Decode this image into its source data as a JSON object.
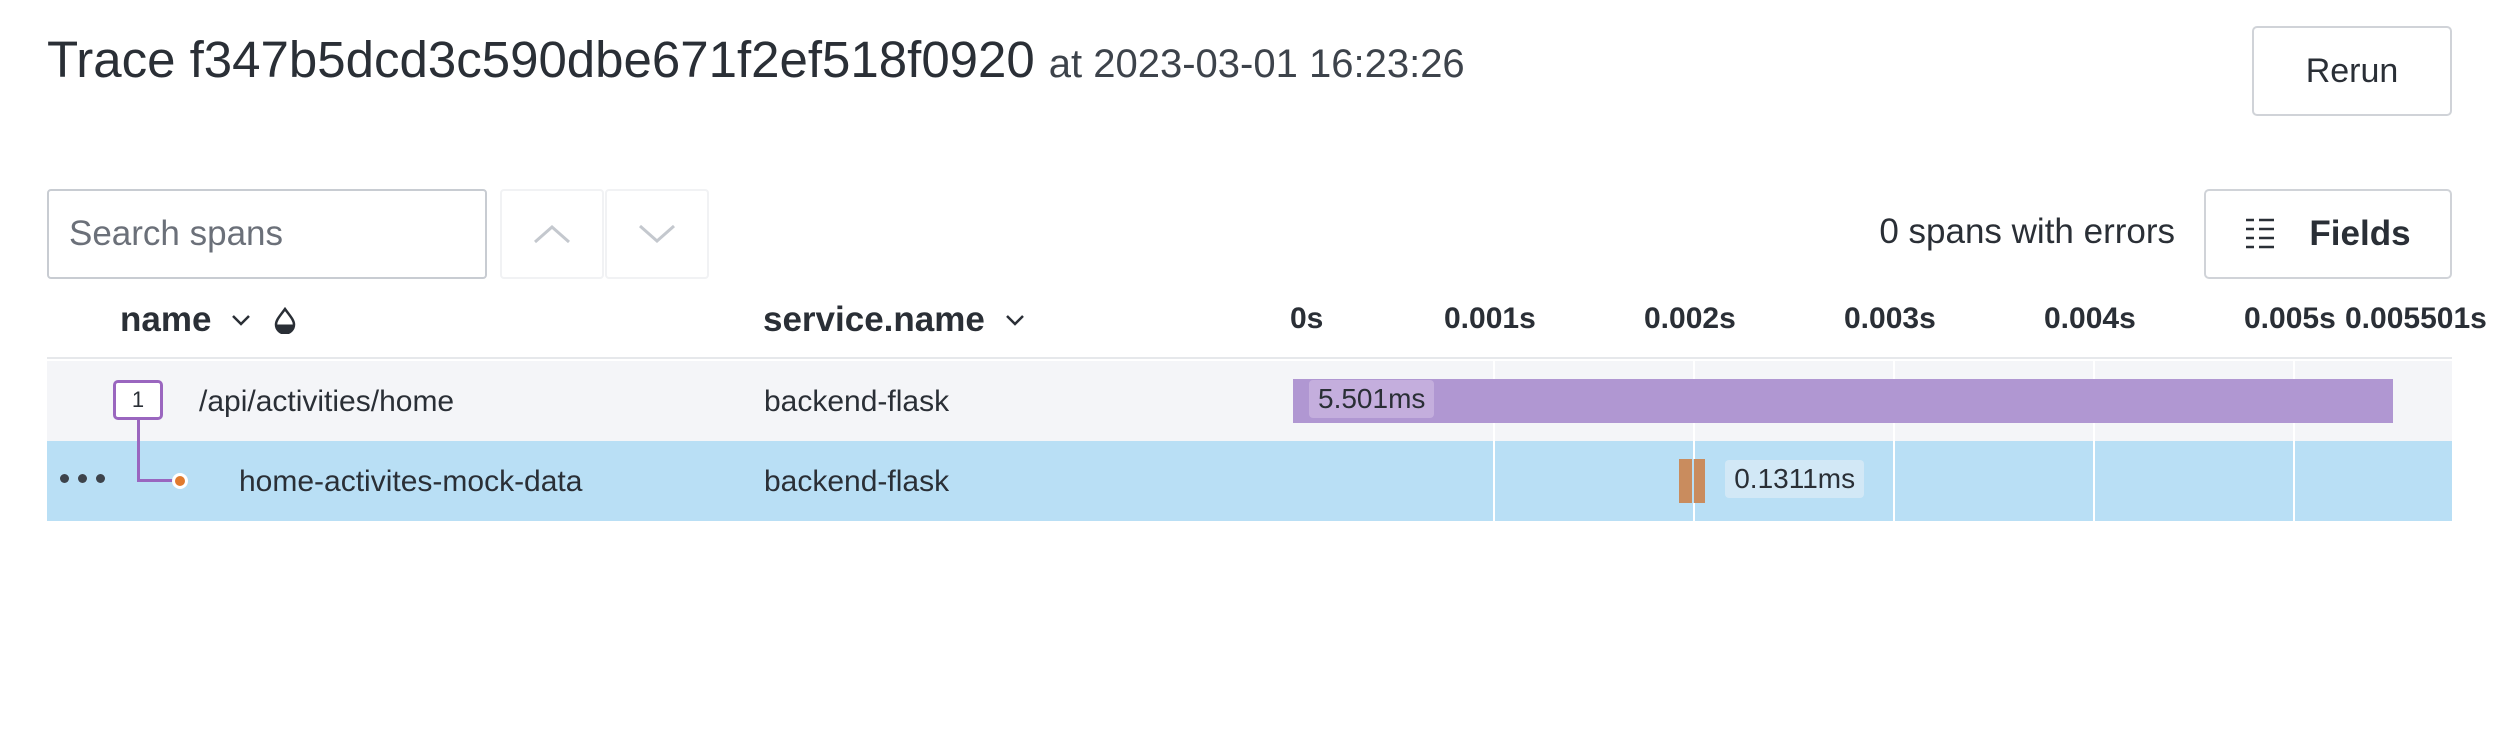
{
  "trace": {
    "title": "Trace f347b5dcd3c590dbe671f2ef518f0920",
    "at_label": "at 2023-03-01 16:23:26",
    "rerun_label": "Rerun"
  },
  "toolbar": {
    "search_placeholder": "Search spans",
    "errors_text": "0 spans with errors",
    "fields_label": "Fields"
  },
  "columns": {
    "name": "name",
    "service": "service.name"
  },
  "timeline": {
    "ticks": [
      "0s",
      "0.001s",
      "0.002s",
      "0.003s",
      "0.004s",
      "0.005s",
      "0.005501s"
    ],
    "total_duration_s": 0.005501
  },
  "rows": [
    {
      "child_count": "1",
      "name": "/api/activities/home",
      "service": "backend-flask",
      "duration_label": "5.501ms",
      "start_s": 0.0,
      "duration_s": 0.005501,
      "bar_color": "#b097d2",
      "label_bg": "#c4aedd"
    },
    {
      "name": "home-activites-mock-data",
      "service": "backend-flask",
      "duration_label": "0.1311ms",
      "start_s": 0.00193,
      "duration_s": 0.0001311,
      "bar_color": "#c98c5e",
      "label_bg": "#d2e8f6"
    }
  ],
  "colors": {
    "accent_purple": "#9a66bf",
    "selected_row": "#b9dff5",
    "error_dot": "#e07a2e"
  }
}
